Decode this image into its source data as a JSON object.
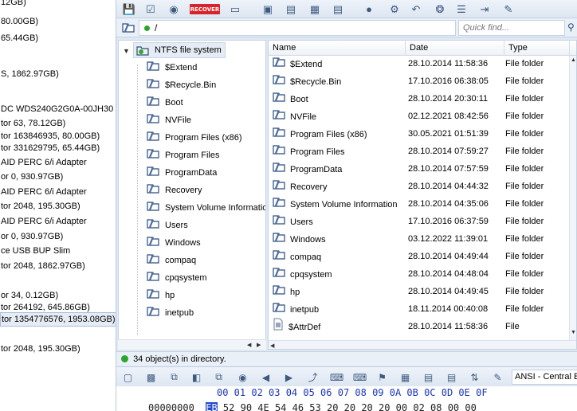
{
  "disk_list": [
    {
      "text": "12GB)"
    },
    {
      "text": " 80.00GB)"
    },
    {
      "text": " 65.44GB)"
    },
    {
      "text": ""
    },
    {
      "text": "S, 1862.97GB)"
    },
    {
      "text": ""
    },
    {
      "text": ""
    },
    {
      "text": "DC WDS240G2G0A-00JH30"
    },
    {
      "text": "tor 63, 78.12GB)"
    },
    {
      "text": "tor 163846935, 80.00GB)"
    },
    {
      "text": "tor 331629795, 65.44GB)"
    },
    {
      "text": "AID PERC 6/i Adapter"
    },
    {
      "text": "or 0, 930.97GB)"
    },
    {
      "text": "AID PERC 6/i Adapter"
    },
    {
      "text": "tor 2048, 195.30GB)"
    },
    {
      "text": "AID PERC 6/i Adapter"
    },
    {
      "text": "or 0, 930.97GB)"
    },
    {
      "text": "ce USB BUP Slim"
    },
    {
      "text": "tor 2048, 1862.97GB)"
    },
    {
      "text": ""
    },
    {
      "text": "or 34, 0.12GB)"
    },
    {
      "text": "tor 264192, 645.86GB)"
    },
    {
      "text": "tor 1354776576, 1953.08GB)"
    },
    {
      "text": ""
    },
    {
      "text": "tor 2048, 195.30GB)"
    }
  ],
  "toolbar": {
    "recover_label": "RECOVER"
  },
  "path": {
    "value": "/",
    "quickfind_placeholder": "Quick find..."
  },
  "tree": {
    "root_label": "NTFS file system",
    "items": [
      "$Extend",
      "$Recycle.Bin",
      "Boot",
      "NVFile",
      "Program Files (x86)",
      "Program Files",
      "ProgramData",
      "Recovery",
      "System Volume Informatio",
      "Users",
      "Windows",
      "compaq",
      "cpqsystem",
      "hp",
      "inetpub"
    ]
  },
  "filelist": {
    "columns": {
      "name": "Name",
      "date": "Date",
      "type": "Type"
    },
    "rows": [
      {
        "name": "$Extend",
        "date": "28.10.2014 11:58:36",
        "type": "File folder"
      },
      {
        "name": "$Recycle.Bin",
        "date": "17.10.2016 06:38:05",
        "type": "File folder"
      },
      {
        "name": "Boot",
        "date": "28.10.2014 20:30:11",
        "type": "File folder"
      },
      {
        "name": "NVFile",
        "date": "02.12.2021 08:42:56",
        "type": "File folder"
      },
      {
        "name": "Program Files (x86)",
        "date": "30.05.2021 01:51:39",
        "type": "File folder"
      },
      {
        "name": "Program Files",
        "date": "28.10.2014 07:59:27",
        "type": "File folder"
      },
      {
        "name": "ProgramData",
        "date": "28.10.2014 07:57:59",
        "type": "File folder"
      },
      {
        "name": "Recovery",
        "date": "28.10.2014 04:44:32",
        "type": "File folder"
      },
      {
        "name": "System Volume Information",
        "date": "28.10.2014 04:35:06",
        "type": "File folder"
      },
      {
        "name": "Users",
        "date": "17.10.2016 06:37:59",
        "type": "File folder"
      },
      {
        "name": "Windows",
        "date": "03.12.2022 11:39:01",
        "type": "File folder"
      },
      {
        "name": "compaq",
        "date": "28.10.2014 04:49:44",
        "type": "File folder"
      },
      {
        "name": "cpqsystem",
        "date": "28.10.2014 04:48:04",
        "type": "File folder"
      },
      {
        "name": "hp",
        "date": "28.10.2014 04:49:45",
        "type": "File folder"
      },
      {
        "name": "inetpub",
        "date": "18.11.2014 00:40:08",
        "type": "File folder"
      },
      {
        "name": "$AttrDef",
        "date": "28.10.2014 11:58:36",
        "type": "File"
      }
    ]
  },
  "status": {
    "text": "34 object(s) in directory."
  },
  "hex": {
    "encoding": "ANSI - Central E",
    "header": "00 01 02 03 04 05 06 07 08 09 0A 0B 0C 0D 0E 0F",
    "row_offset": "00000000",
    "row_selected": "EB",
    "row_rest": " 52 90 4E 54 46 53 20 20 20 20 00 02 08 00 00"
  },
  "colors": {
    "accent": "#2048d0",
    "status_ok": "#2aa62a",
    "recover": "#d8232a",
    "folder": "#2c4c7c"
  }
}
